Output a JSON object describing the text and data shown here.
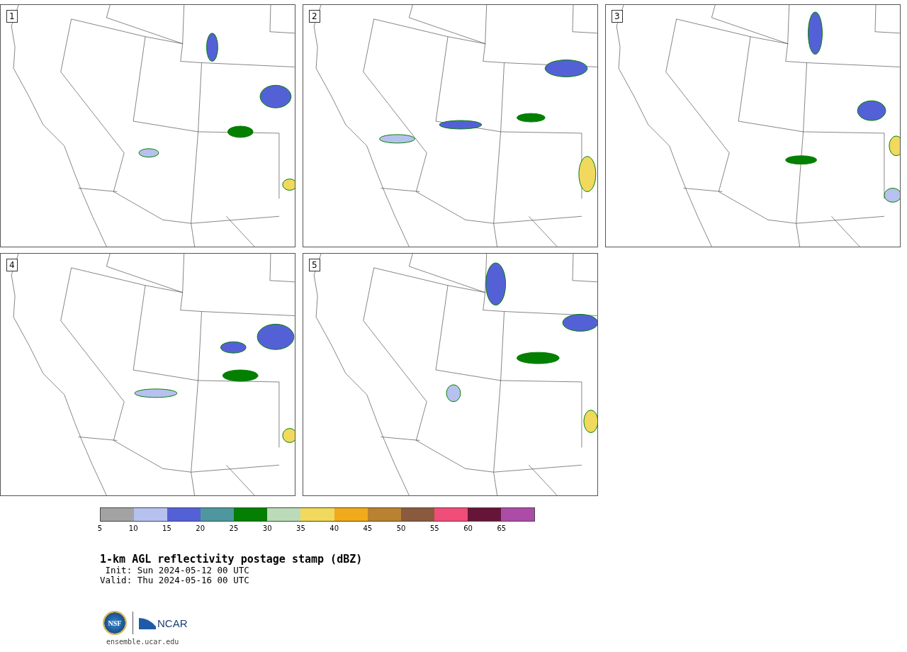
{
  "panels": [
    {
      "label": "1"
    },
    {
      "label": "2"
    },
    {
      "label": "3"
    },
    {
      "label": "4"
    },
    {
      "label": "5"
    }
  ],
  "colorbar": {
    "segments": [
      {
        "color": "#a3a3a3",
        "tick": "5"
      },
      {
        "color": "#b7c1ef",
        "tick": "10"
      },
      {
        "color": "#5461d6",
        "tick": "15"
      },
      {
        "color": "#4e979f",
        "tick": "20"
      },
      {
        "color": "#037f01",
        "tick": "25"
      },
      {
        "color": "#bcdbb9",
        "tick": "30"
      },
      {
        "color": "#f0d95d",
        "tick": "35"
      },
      {
        "color": "#f0aa1b",
        "tick": "40"
      },
      {
        "color": "#b98230",
        "tick": "45"
      },
      {
        "color": "#8a5a3e",
        "tick": "50"
      },
      {
        "color": "#f14d79",
        "tick": "55"
      },
      {
        "color": "#661538",
        "tick": "60"
      },
      {
        "color": "#ad4ca7",
        "tick": "65"
      }
    ]
  },
  "title": "1-km AGL reflectivity postage stamp (dBZ)",
  "init": " Init: Sun 2024-05-12 00 UTC",
  "valid": "Valid: Thu 2024-05-16 00 UTC",
  "logo": {
    "nsf": "NSF",
    "ncar": "NCAR"
  },
  "url": "ensemble.ucar.edu"
}
